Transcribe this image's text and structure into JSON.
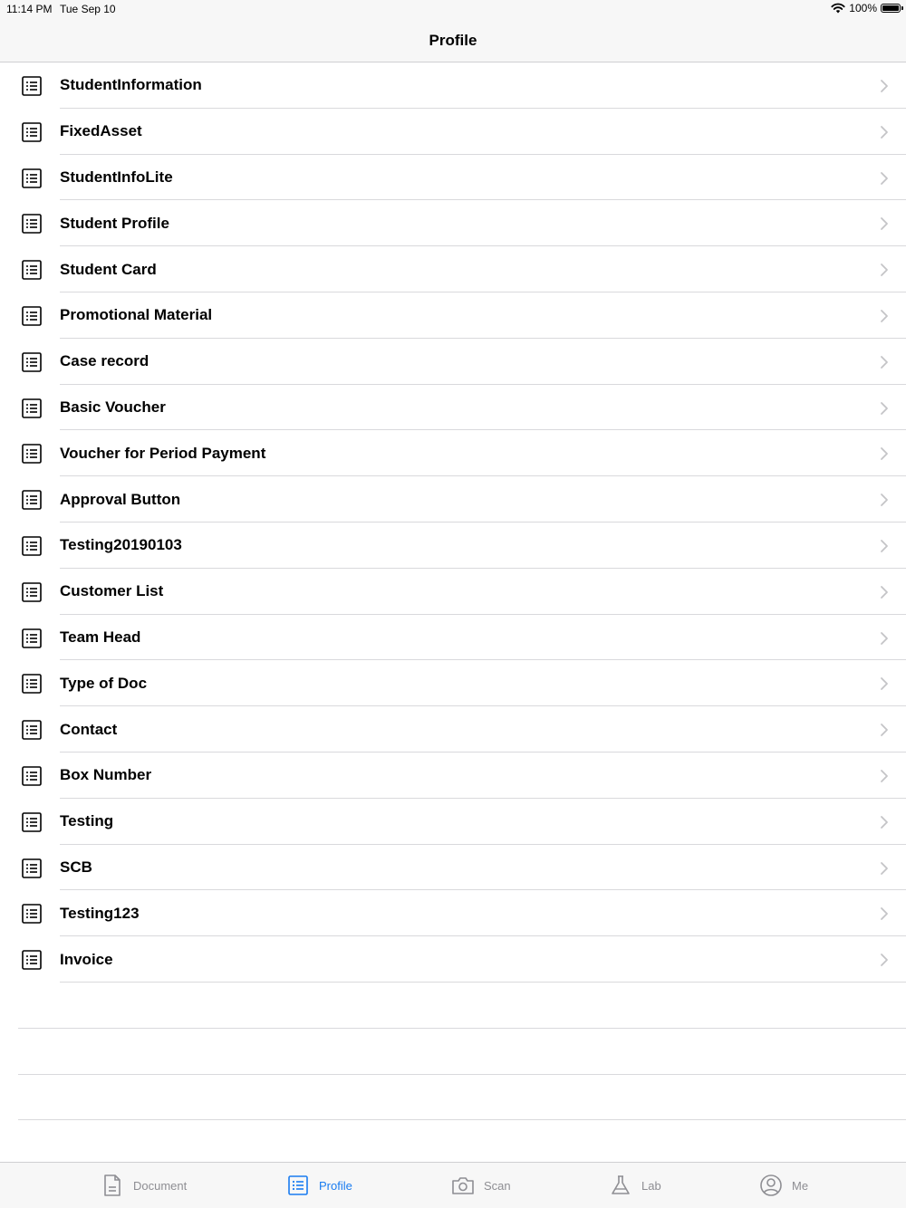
{
  "status_bar": {
    "time": "11:14 PM",
    "date": "Tue Sep 10",
    "battery": "100%"
  },
  "nav": {
    "title": "Profile"
  },
  "items": [
    {
      "label": "StudentInformation"
    },
    {
      "label": "FixedAsset"
    },
    {
      "label": "StudentInfoLite"
    },
    {
      "label": "Student Profile"
    },
    {
      "label": "Student Card"
    },
    {
      "label": "Promotional Material"
    },
    {
      "label": "Case record"
    },
    {
      "label": "Basic Voucher"
    },
    {
      "label": "Voucher for Period Payment"
    },
    {
      "label": "Approval Button"
    },
    {
      "label": "Testing20190103"
    },
    {
      "label": "Customer List"
    },
    {
      "label": "Team Head"
    },
    {
      "label": "Type of Doc"
    },
    {
      "label": "Contact"
    },
    {
      "label": "Box Number"
    },
    {
      "label": "Testing"
    },
    {
      "label": "SCB"
    },
    {
      "label": "Testing123"
    },
    {
      "label": "Invoice"
    }
  ],
  "tabs": [
    {
      "label": "Document",
      "icon": "document-icon",
      "active": false
    },
    {
      "label": "Profile",
      "icon": "list-icon",
      "active": true
    },
    {
      "label": "Scan",
      "icon": "camera-icon",
      "active": false
    },
    {
      "label": "Lab",
      "icon": "flask-icon",
      "active": false
    },
    {
      "label": "Me",
      "icon": "person-icon",
      "active": false
    }
  ],
  "colors": {
    "accent": "#1a7cf0",
    "inactive": "#8e8e93",
    "bar_bg": "#f7f7f7"
  }
}
